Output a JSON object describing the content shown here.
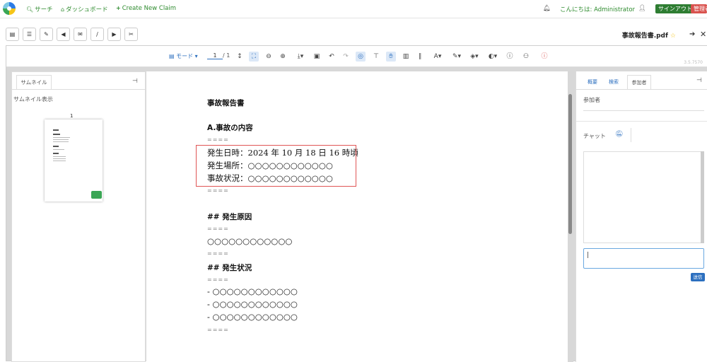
{
  "nav": {
    "search": "サーチ",
    "dashboard": "ダッシュボード",
    "create_claim": "Create New Claim",
    "greeting": "こんにちは:",
    "user": "Administrator",
    "signout": "サインアウト",
    "admin": "管理者"
  },
  "doc": {
    "title": "事故報告書.pdf"
  },
  "viewer_toolbar": {
    "mode": "モード",
    "page_current": "1",
    "page_total": "/ 1",
    "version": "3.5.7570"
  },
  "left_panel": {
    "tab": "サムネイル",
    "heading": "サムネイル表示",
    "thumb_number": "1"
  },
  "page": {
    "title": "事故報告書",
    "section_a": "A.事故の内容",
    "sep": "====",
    "line1": "発生日時：2024 年 10 月 18 日 16 時頃",
    "line2": "発生場所：○○○○○○○○○○○○",
    "line3": "事故状況：○○○○○○○○○○○○",
    "h_cause": "## 発生原因",
    "cause_text": "○○○○○○○○○○○○",
    "h_status": "## 発生状況",
    "item1": "- ○○○○○○○○○○○○",
    "item2": "- ○○○○○○○○○○○○",
    "item3": "- ○○○○○○○○○○○○"
  },
  "right_panel": {
    "tabs": [
      "概要",
      "検索",
      "参加者"
    ],
    "participants_label": "参加者",
    "chat_label": "チャット",
    "send": "送信"
  },
  "colors": {
    "nav_green": "#2e8b2e",
    "signout_bg": "#2e7d32",
    "admin_bg": "#d9534f",
    "highlight_red": "#e05555",
    "accent_blue": "#2c6fbf"
  }
}
